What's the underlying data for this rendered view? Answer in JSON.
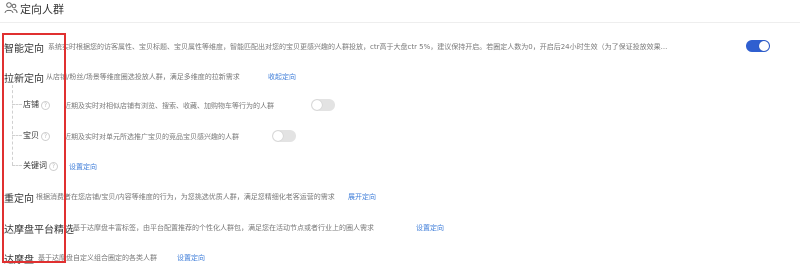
{
  "header": {
    "title": "定向人群",
    "icon": "people-icon"
  },
  "rows": {
    "smart": {
      "label": "智能定向",
      "desc": "系统实时根据您的访客属性、宝贝标题、宝贝属性等维度，智能匹配出对您的宝贝更感兴趣的人群投放，ctr高于大盘ctr 5%，建议保持开启。若圈定人数为0，开启后24小时生效（为了保证投放效果...",
      "toggle_on": true
    },
    "acquire": {
      "label": "拉新定向",
      "desc": "从店铺/粉丝/场景等维度圈选投放人群，满足多维度的拉新需求",
      "link": "收起定向",
      "sub": [
        {
          "label": "店铺",
          "desc": "近期及实时对相似店铺有浏览、搜索、收藏、加购物车等行为的人群",
          "toggle_on": false
        },
        {
          "label": "宝贝",
          "desc": "近期及实时对单元所选推广宝贝的竞品宝贝感兴趣的人群",
          "toggle_on": false
        },
        {
          "label": "关键词",
          "link": "设置定向"
        }
      ]
    },
    "retarget": {
      "label": "重定向",
      "desc": "根据消费者在您店铺/宝贝/内容等维度的行为，为您挑选优质人群，满足您精细化老客运营的需求",
      "link": "展开定向"
    },
    "damopan_select": {
      "label": "达摩盘平台精选",
      "desc": "基于达摩盘丰富标签，由平台配置推荐的个性化人群包，满足您在活动节点或者行业上的圈人需求",
      "link": "设置定向"
    },
    "damopan": {
      "label": "达摩盘",
      "desc": "基于达摩盘自定义组合圈定的各类人群",
      "link": "设置定向"
    }
  },
  "colors": {
    "accent": "#2f5fd0",
    "link": "#3b7bd8",
    "highlight": "#e03030"
  }
}
